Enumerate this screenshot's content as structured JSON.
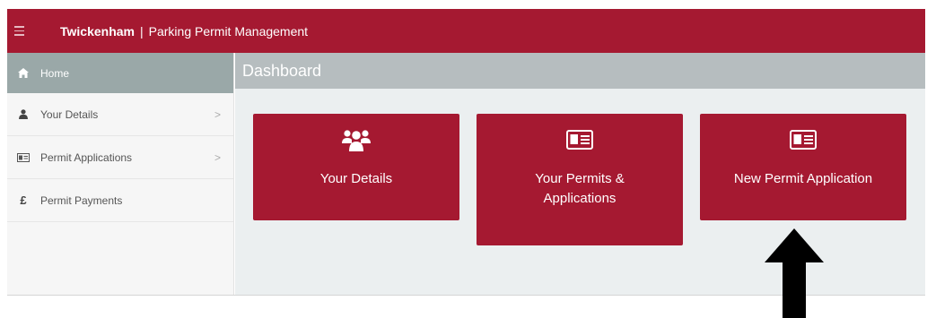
{
  "header": {
    "brand": "Twickenham",
    "separator": "|",
    "subtitle": "Parking Permit Management",
    "menu_icon": "hamburger-icon"
  },
  "sidebar": {
    "items": [
      {
        "label": "Home",
        "icon": "home-icon",
        "active": true
      },
      {
        "label": "Your Details",
        "icon": "user-icon",
        "chevron": ">"
      },
      {
        "label": "Permit Applications",
        "icon": "id-card-icon",
        "chevron": ">"
      },
      {
        "label": "Permit Payments",
        "icon": "pound-icon",
        "glyph": "£"
      }
    ]
  },
  "dashboard": {
    "title": "Dashboard",
    "tiles": [
      {
        "label": "Your Details",
        "icon": "users-icon"
      },
      {
        "label": "Your Permits & Applications",
        "icon": "id-card-icon"
      },
      {
        "label": "New Permit Application",
        "icon": "id-card-icon"
      }
    ]
  },
  "colors": {
    "brand_red": "#a51931",
    "sidebar_active": "#9aa8a8",
    "dashboard_header": "#b6bdbf",
    "main_bg": "#ebeff0"
  }
}
